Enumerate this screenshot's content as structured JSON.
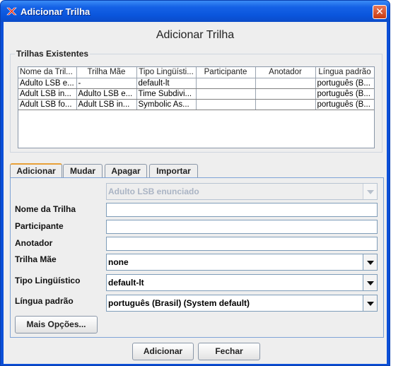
{
  "window": {
    "title": "Adicionar Trilha",
    "close_glyph": "✕"
  },
  "heading": "Adicionar Trilha",
  "existing_tracks": {
    "group_title": "Trilhas Existentes",
    "columns": [
      "Nome da Tril...",
      "Trilha Mãe",
      "Tipo Lingüísti...",
      "Participante",
      "Anotador",
      "Língua padrão"
    ],
    "rows": [
      [
        "Adulto LSB e...",
        "-",
        "default-lt",
        "",
        "",
        "português (B..."
      ],
      [
        "Adult LSB in...",
        "Adulto LSB e...",
        "Time Subdivi...",
        "",
        "",
        "português (B..."
      ],
      [
        "Adult LSB fo...",
        "Adult LSB in...",
        "Symbolic As...",
        "",
        "",
        "português (B..."
      ]
    ]
  },
  "tabs": [
    "Adicionar",
    "Mudar",
    "Apagar",
    "Importar"
  ],
  "form": {
    "track_select": "Adulto LSB enunciado",
    "track_name_label": "Nome da Trilha",
    "track_name_value": "",
    "participant_label": "Participante",
    "participant_value": "",
    "annotator_label": "Anotador",
    "annotator_value": "",
    "parent_label": "Trilha Mãe",
    "parent_value": "none",
    "ling_type_label": "Tipo Lingüístico",
    "ling_type_value": "default-lt",
    "language_label": "Língua padrão",
    "language_value": "português (Brasil) (System default)",
    "more_options": "Mais Opções..."
  },
  "buttons": {
    "add": "Adicionar",
    "close": "Fechar"
  },
  "colors": {
    "titlebar": "#0b55dc",
    "tab_active_accent": "#e8a038",
    "close_button": "#c83a10"
  },
  "icons": [
    "app-icon",
    "close-icon",
    "chevron-down-icon"
  ]
}
